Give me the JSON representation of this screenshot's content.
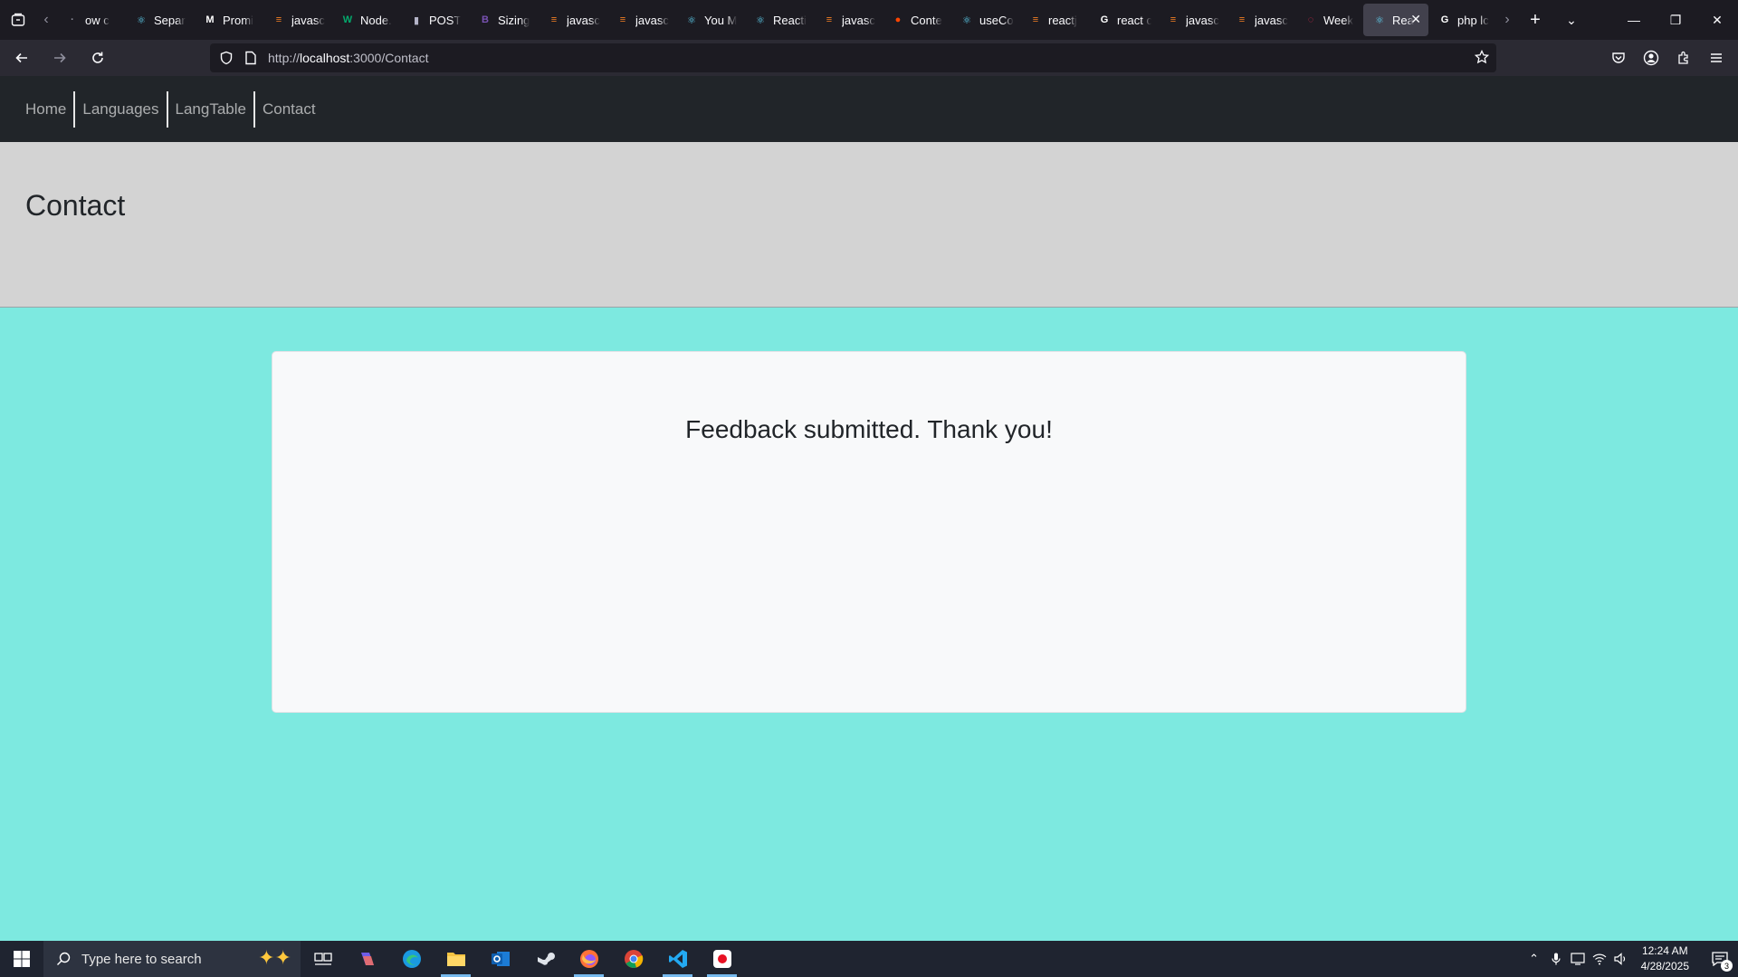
{
  "browser": {
    "tabs": [
      {
        "label": "ow c",
        "icon": "generic-icon",
        "color": "#8f8f9d"
      },
      {
        "label": "Separ",
        "icon": "react-icon",
        "color": "#61dafb"
      },
      {
        "label": "Promi",
        "icon": "mdn-icon",
        "color": "#ffffff"
      },
      {
        "label": "javasc",
        "icon": "stackoverflow-icon",
        "color": "#f48024"
      },
      {
        "label": "Node.",
        "icon": "w3schools-icon",
        "color": "#04aa6d"
      },
      {
        "label": "POST",
        "icon": "postman-icon",
        "color": "#b4b4c8"
      },
      {
        "label": "Sizing",
        "icon": "bootstrap-icon",
        "color": "#7952b3"
      },
      {
        "label": "javasc",
        "icon": "stackoverflow-icon",
        "color": "#f48024"
      },
      {
        "label": "javasc",
        "icon": "stackoverflow-icon",
        "color": "#f48024"
      },
      {
        "label": "You M",
        "icon": "react-icon",
        "color": "#61dafb"
      },
      {
        "label": "Reacti",
        "icon": "react-icon",
        "color": "#61dafb"
      },
      {
        "label": "javasc",
        "icon": "stackoverflow-icon",
        "color": "#f48024"
      },
      {
        "label": "Conte",
        "icon": "reddit-icon",
        "color": "#ff4500"
      },
      {
        "label": "useCo",
        "icon": "react-icon",
        "color": "#61dafb"
      },
      {
        "label": "reactj",
        "icon": "stackoverflow-icon",
        "color": "#f48024"
      },
      {
        "label": "react c",
        "icon": "google-icon",
        "color": "#ffffff"
      },
      {
        "label": "javasc",
        "icon": "stackoverflow-icon",
        "color": "#f48024"
      },
      {
        "label": "javasc",
        "icon": "stackoverflow-icon",
        "color": "#f48024"
      },
      {
        "label": "Week",
        "icon": "loading-icon",
        "color": "#e22850"
      },
      {
        "label": "Rea",
        "icon": "react-icon",
        "color": "#61dafb",
        "active": true
      },
      {
        "label": "php lc",
        "icon": "google-icon",
        "color": "#ffffff"
      }
    ],
    "url_prefix": "http://",
    "url_host": "localhost",
    "url_path": ":3000/Contact"
  },
  "app": {
    "nav": [
      "Home",
      "Languages",
      "LangTable",
      "Contact"
    ],
    "page_title": "Contact",
    "message": "Feedback submitted. Thank you!"
  },
  "taskbar": {
    "search_placeholder": "Type here to search",
    "apps": [
      {
        "name": "task-view-icon",
        "running": false
      },
      {
        "name": "copilot-icon",
        "running": false
      },
      {
        "name": "edge-icon",
        "running": false
      },
      {
        "name": "file-explorer-icon",
        "running": true
      },
      {
        "name": "outlook-icon",
        "running": false
      },
      {
        "name": "steam-icon",
        "running": false
      },
      {
        "name": "firefox-icon",
        "running": true
      },
      {
        "name": "chrome-icon",
        "running": false
      },
      {
        "name": "vscode-icon",
        "running": true
      },
      {
        "name": "recorder-icon",
        "running": true
      }
    ],
    "time": "12:24 AM",
    "date": "4/28/2025",
    "notification_count": "3"
  },
  "colors": {
    "page_bg": "#7de9e0",
    "header_band": "#d3d3d3",
    "app_nav_bg": "#212529",
    "card_bg": "#f8f9fa"
  }
}
